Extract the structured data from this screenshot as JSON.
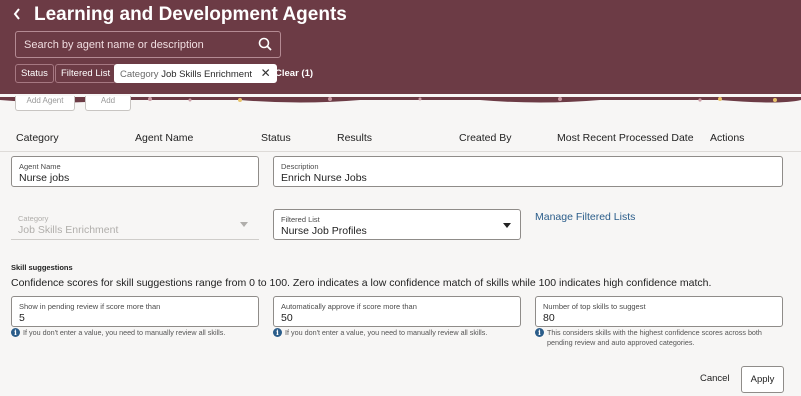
{
  "header": {
    "title": "Learning and Development Agents",
    "search_placeholder": "Search by agent name or description",
    "chips": [
      "Status",
      "Filtered List"
    ],
    "active_chip": {
      "label": "Category",
      "value": "Job Skills Enrichment"
    },
    "clear_label": "Clear (1)",
    "background_color": "#6c3b45"
  },
  "toolbar": {
    "hidden_button_1": "Add Agent",
    "hidden_button_2": "Add"
  },
  "table": {
    "columns": [
      "Category",
      "Agent Name",
      "Status",
      "Results",
      "Created By",
      "Most Recent Processed Date",
      "Actions"
    ]
  },
  "form": {
    "agent_name": {
      "label": "Agent Name",
      "value": "Nurse jobs"
    },
    "description": {
      "label": "Description",
      "value": "Enrich Nurse Jobs"
    },
    "category": {
      "label": "Category",
      "value": "Job Skills Enrichment"
    },
    "filtered_list": {
      "label": "Filtered List",
      "value": "Nurse Job Profiles"
    },
    "manage_link": "Manage Filtered Lists",
    "skill_section_title": "Skill suggestions",
    "skill_description": "Confidence scores for skill suggestions range from 0 to 100. Zero indicates a low confidence match of skills while 100 indicates high confidence match.",
    "pending_review": {
      "label": "Show in pending review if score more than",
      "value": "5",
      "help": "If you don't enter a value, you need to manually review all skills."
    },
    "auto_approve": {
      "label": "Automatically approve if score more than",
      "value": "50",
      "help": "If you don't enter a value, you need to manually review all skills."
    },
    "top_skills": {
      "label": "Number of top skills to suggest",
      "value": "80",
      "help_line1": "This considers skills with the highest confidence scores across both",
      "help_line2": "pending review and auto approved categories."
    }
  },
  "actions": {
    "cancel": "Cancel",
    "apply": "Apply"
  },
  "colors": {
    "link": "#2b5d8a",
    "info": "#2b5d8a"
  }
}
